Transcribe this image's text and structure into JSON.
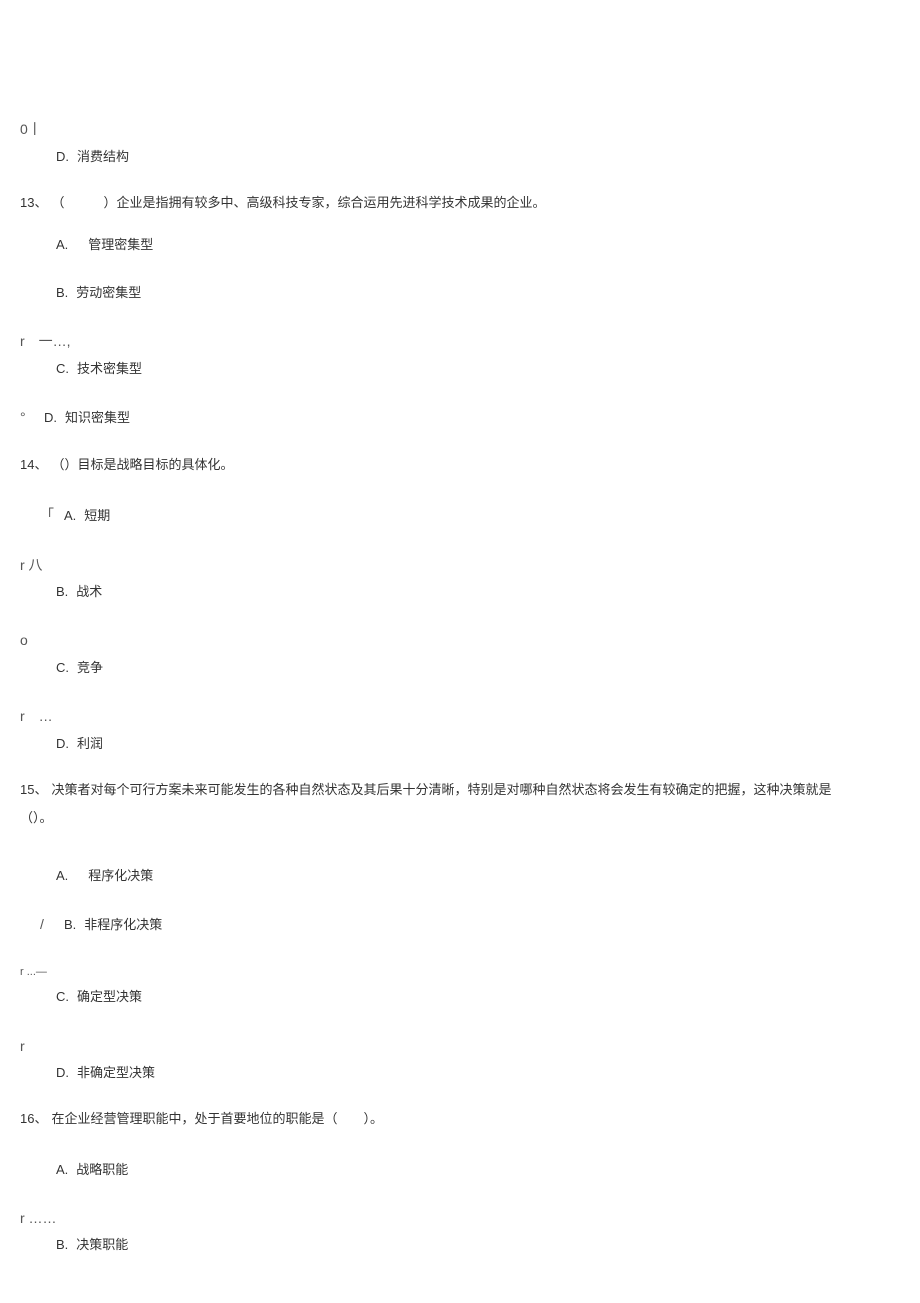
{
  "q12": {
    "marker_d": "0丨",
    "optD_label": "D.",
    "optD_text": "消费结构"
  },
  "q13": {
    "num": "13、",
    "stem": "（　　　）企业是指拥有较多中、高级科技专家，综合运用先进科学技术成果的企业。",
    "optA_label": "A.",
    "optA_text": "管理密集型",
    "optB_label": "B.",
    "optB_text": "劳动密集型",
    "marker_c": "r　一…,",
    "optC_label": "C.",
    "optC_text": "技术密集型",
    "marker_d_prefix": "°",
    "optD_label": "D.",
    "optD_text": "知识密集型"
  },
  "q14": {
    "num": "14、",
    "stem": "（）目标是战略目标的具体化。",
    "marker_a_prefix": "「",
    "optA_label": "A.",
    "optA_text": "短期",
    "marker_b": "r 八",
    "optB_label": "B.",
    "optB_text": "战术",
    "marker_c": "o",
    "optC_label": "C.",
    "optC_text": "竞争",
    "marker_d": "r　…",
    "optD_label": "D.",
    "optD_text": "利润"
  },
  "q15": {
    "num": "15、",
    "stem_line1": "决策者对每个可行方案未来可能发生的各种自然状态及其后果十分清晰，特别是对哪种自然状态将会发生有较确定的把握，这种决策就是",
    "stem_line2": "（）。",
    "optA_label": "A.",
    "optA_text": "程序化决策",
    "marker_b_prefix": "/",
    "optB_label": "B.",
    "optB_text": "非程序化决策",
    "marker_c": "r ...—",
    "optC_label": "C.",
    "optC_text": "确定型决策",
    "marker_d": "r",
    "optD_label": "D.",
    "optD_text": "非确定型决策"
  },
  "q16": {
    "num": "16、",
    "stem": "在企业经营管理职能中，处于首要地位的职能是（　　）。",
    "optA_label": "A.",
    "optA_text": "战略职能",
    "marker_b": "r ……",
    "optB_label": "B.",
    "optB_text": "决策职能"
  }
}
